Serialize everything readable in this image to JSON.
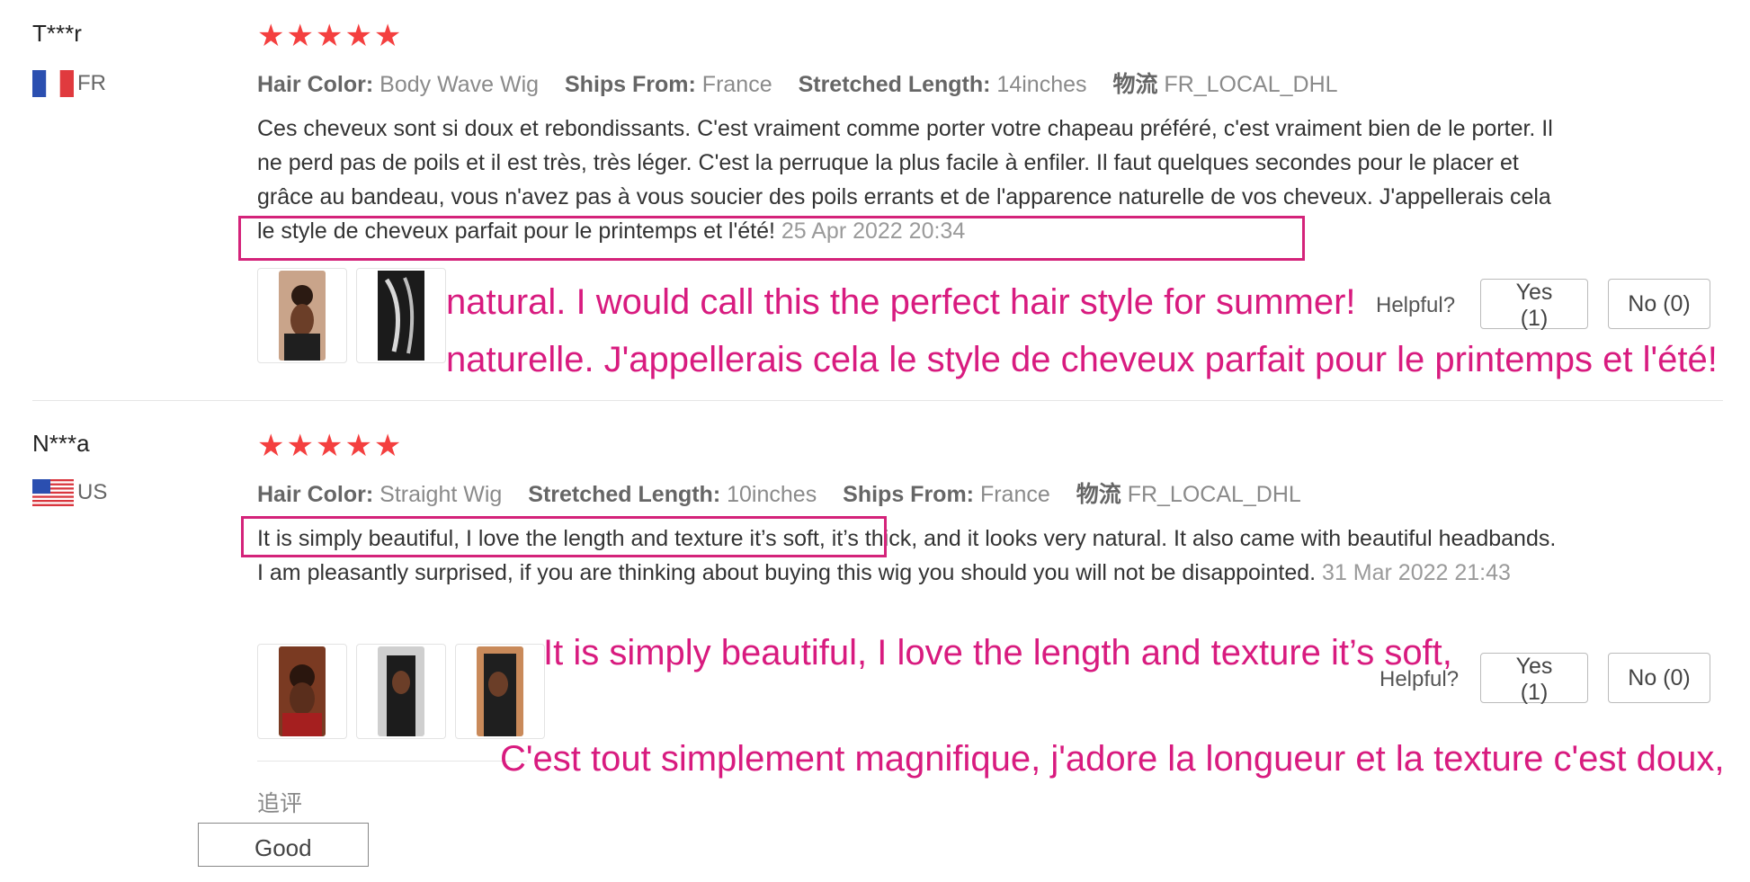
{
  "reviews": [
    {
      "user": "T***r",
      "country": "FR",
      "stars": "★★★★★",
      "attrs": [
        {
          "label": "Hair Color:",
          "value": "Body Wave Wig"
        },
        {
          "label": "Ships From:",
          "value": "France"
        },
        {
          "label": "Stretched Length:",
          "value": "14inches"
        },
        {
          "label": "物流",
          "value": "FR_LOCAL_DHL"
        }
      ],
      "text": "Ces cheveux sont si doux et rebondissants. C'est vraiment comme porter votre chapeau préféré, c'est vraiment bien de le porter. Il ne perd pas de poils et il est très, très léger. C'est la perruque la plus facile à enfiler. Il faut quelques secondes pour le placer et grâce au bandeau, vous n'avez pas à vous soucier des poils errants et de l'apparence naturelle de vos cheveux. J'appellerais cela le style de cheveux parfait pour le printemps et l'été!",
      "date": "25 Apr 2022 20:34",
      "helpful_label": "Helpful?",
      "yes_label": "Yes (1)",
      "no_label": "No (0)"
    },
    {
      "user": "N***a",
      "country": "US",
      "stars": "★★★★★",
      "attrs": [
        {
          "label": "Hair Color:",
          "value": "Straight Wig"
        },
        {
          "label": "Stretched Length:",
          "value": "10inches"
        },
        {
          "label": "Ships From:",
          "value": "France"
        },
        {
          "label": "物流",
          "value": "FR_LOCAL_DHL"
        }
      ],
      "text": "It is simply beautiful, I love the length and texture it’s soft, it’s thick, and it looks very natural. It also came with beautiful headbands. I am pleasantly surprised, if you are thinking about buying this wig you should you will not be disappointed.",
      "date": "31 Mar 2022 21:43",
      "helpful_label": "Helpful?",
      "yes_label": "Yes (1)",
      "no_label": "No (0)",
      "followup_label": "追评",
      "followup_text": "Good"
    }
  ],
  "annotations": {
    "a1_en": "natural. I would call this the perfect hair style for summer!",
    "a1_fr": "naturelle. J'appellerais cela le style de cheveux parfait pour le printemps et l'été!",
    "a2_en": "It is simply beautiful, I love the length and texture it’s soft,",
    "a2_fr": "C'est tout simplement magnifique, j'adore la longueur et la texture c'est doux,"
  },
  "colors": {
    "star": "#f43f3f",
    "annotation": "#d81b7f",
    "highlight_box": "#d4237a"
  }
}
